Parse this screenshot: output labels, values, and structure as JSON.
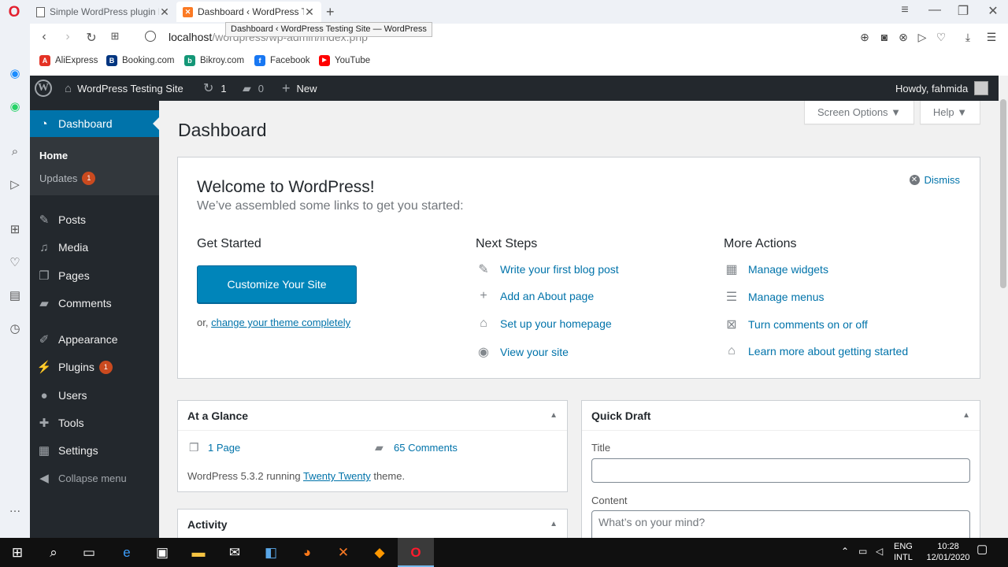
{
  "browser": {
    "tabs": [
      {
        "title": "Simple WordPress plugin D",
        "icon": "document-icon"
      },
      {
        "title": "Dashboard ‹ WordPress Tes",
        "icon": "xampp-icon"
      }
    ],
    "url_host": "localhost",
    "url_path": "/wordpress/wp-admin/index.php",
    "tooltip": "Dashboard ‹ WordPress Testing Site — WordPress",
    "bookmarks": [
      {
        "label": "AliExpress",
        "color": "#e43225",
        "glyph": "A"
      },
      {
        "label": "Booking.com",
        "color": "#003580",
        "glyph": "B"
      },
      {
        "label": "Bikroy.com",
        "color": "#149777",
        "glyph": "b"
      },
      {
        "label": "Facebook",
        "color": "#1877f2",
        "glyph": "f"
      },
      {
        "label": "YouTube",
        "color": "#ff0000",
        "glyph": "▶"
      }
    ]
  },
  "adminbar": {
    "site_name": "WordPress Testing Site",
    "updates_count": "1",
    "comments_count": "0",
    "new_label": "New",
    "howdy": "Howdy, fahmida"
  },
  "menu": {
    "dashboard": "Dashboard",
    "home": "Home",
    "updates": "Updates",
    "updates_badge": "1",
    "posts": "Posts",
    "media": "Media",
    "pages": "Pages",
    "comments": "Comments",
    "appearance": "Appearance",
    "plugins": "Plugins",
    "plugins_badge": "1",
    "users": "Users",
    "tools": "Tools",
    "settings": "Settings",
    "collapse": "Collapse menu"
  },
  "main": {
    "screen_options": "Screen Options ▼",
    "help": "Help ▼",
    "title": "Dashboard",
    "welcome": {
      "heading": "Welcome to WordPress!",
      "about": "We’ve assembled some links to get you started:",
      "dismiss": "Dismiss",
      "get_started": "Get Started",
      "customize_btn": "Customize Your Site",
      "or_text": "or,",
      "change_theme": "change your theme completely",
      "next_steps": "Next Steps",
      "steps": [
        "Write your first blog post",
        "Add an About page",
        "Set up your homepage",
        "View your site"
      ],
      "more_actions": "More Actions",
      "actions": [
        "Manage widgets",
        "Manage menus",
        "Turn comments on or off",
        "Learn more about getting started"
      ]
    },
    "glance": {
      "title": "At a Glance",
      "pages": "1 Page",
      "comments": "65 Comments",
      "wp_prefix": "WordPress 5.3.2 running",
      "theme": "Twenty Twenty",
      "wp_suffix": "theme."
    },
    "activity": {
      "title": "Activity"
    },
    "quick_draft": {
      "title": "Quick Draft",
      "title_label": "Title",
      "content_label": "Content",
      "content_placeholder": "What’s on your mind?"
    }
  },
  "taskbar": {
    "lang_top": "ENG",
    "lang_bottom": "INTL",
    "time": "10:28",
    "date": "12/01/2020"
  }
}
